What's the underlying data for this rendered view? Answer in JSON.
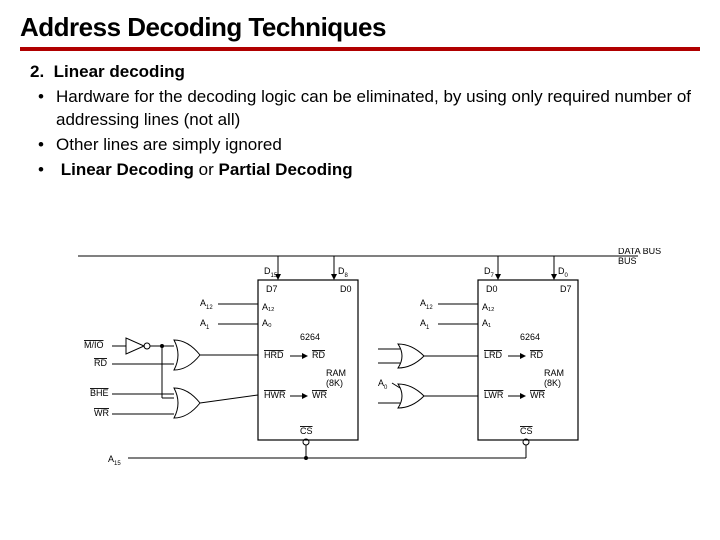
{
  "title": "Address Decoding Techniques",
  "item_number": "2.",
  "item_title": "Linear decoding",
  "bullets": {
    "b1": "Hardware for the decoding logic can be eliminated, by using only required number of addressing lines (not all)",
    "b2": "Other lines are simply ignored",
    "b3_prefix": "",
    "b3_bold1": "Linear Decoding",
    "b3_mid": " or ",
    "b3_bold2": "Partial Decoding"
  },
  "diagram": {
    "data_bus": "DATA BUS",
    "d15": "D",
    "d15s": "15",
    "d8": "D",
    "d8s": "8",
    "d7_top": "D",
    "d7s_top": "7",
    "d0_top": "D",
    "d0s_top": "0",
    "chip_d7": "D7",
    "chip_d0": "D0",
    "chip2_d0": "D0",
    "chip2_d7": "D7",
    "a12": "A",
    "a12s": "12",
    "a1": "A",
    "a1s": "1",
    "a1_chip": "A₁",
    "a12_chip": "A₁₂",
    "a0_chip": "A₀",
    "chip_name": "6264",
    "ram": "RAM",
    "size": "(8K)",
    "hrd": "HRD",
    "hwr": "HWR",
    "lrd": "LRD",
    "lwr": "LWR",
    "rd": "RD",
    "wr": "WR",
    "cs": "CS",
    "mio": "M/IO",
    "bhe": "BHE",
    "a0": "A",
    "a0s": "0",
    "a19": "A",
    "a19s": "15"
  }
}
